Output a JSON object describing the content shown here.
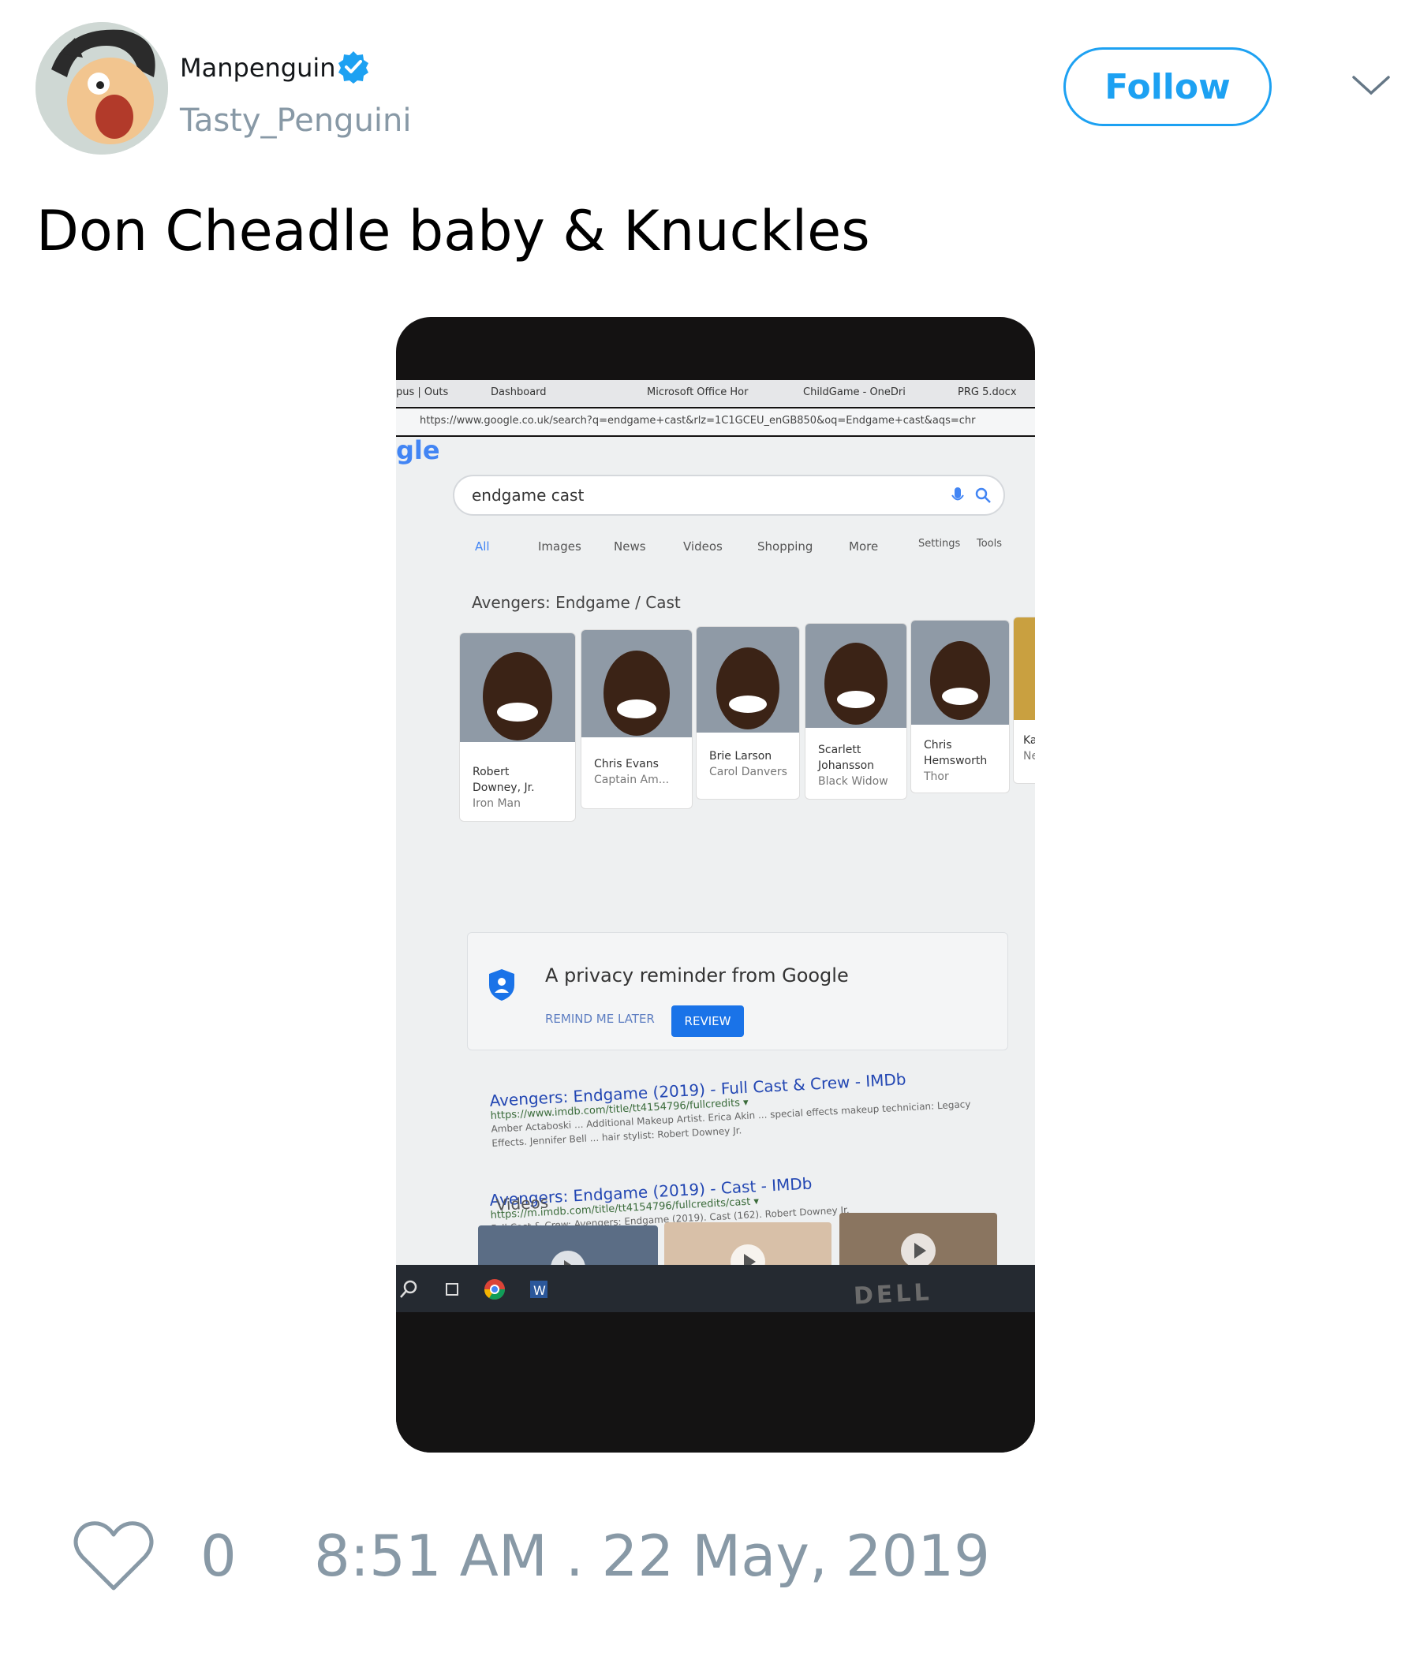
{
  "tweet": {
    "display_name": "Manpenguin",
    "handle": "Tasty_Penguini",
    "follow_label": "Follow",
    "text": "Don Cheadle baby & Knuckles",
    "like_count": "0",
    "timestamp": "8:51 AM . 22 May, 2019",
    "verified": true,
    "colors": {
      "accent": "#1da1f2",
      "muted": "#8899a6"
    }
  },
  "photo": {
    "tabs": [
      "pus | Outs",
      "Dashboard",
      "Microsoft Office Hor",
      "ChildGame - OneDri",
      "PRG 5.docx"
    ],
    "url": "https://www.google.co.uk/search?q=endgame+cast&rlz=1C1GCEU_enGB850&oq=Endgame+cast&aqs=chr",
    "logo_fragment": "gle",
    "query": "endgame cast",
    "nav": [
      "All",
      "Images",
      "News",
      "Videos",
      "Shopping",
      "More",
      "Settings",
      "Tools"
    ],
    "cast_title": "Avengers: Endgame / Cast",
    "cast": [
      {
        "name1": "Robert",
        "name2": "Downey, Jr.",
        "role": "Iron Man"
      },
      {
        "name1": "Chris Evans",
        "name2": "",
        "role": "Captain Am..."
      },
      {
        "name1": "Brie Larson",
        "name2": "",
        "role": "Carol Danvers"
      },
      {
        "name1": "Scarlett",
        "name2": "Johansson",
        "role": "Black Widow"
      },
      {
        "name1": "Chris",
        "name2": "Hemsworth",
        "role": "Thor"
      },
      {
        "name1": "Ka",
        "name2": "",
        "role": "Ne"
      }
    ],
    "privacy": {
      "title": "A privacy reminder from Google",
      "remind": "REMIND ME LATER",
      "review": "REVIEW"
    },
    "results": [
      {
        "title": "Avengers: Endgame (2019) - Full Cast & Crew - IMDb",
        "url": "https://www.imdb.com/title/tt4154796/fullcredits ▾",
        "snippet1": "Amber Actaboski ... Additional Makeup Artist. Erica Akin ... special effects makeup technician: Legacy",
        "snippet2": "Effects. Jennifer Bell ... hair stylist: Robert Downey Jr."
      },
      {
        "title": "Avengers: Endgame (2019) - Cast - IMDb",
        "url": "https://m.imdb.com/title/tt4154796/fullcredits/cast ▾",
        "snippet1": "Full Cast & Crew: Avengers: Endgame (2019). Cast (162). Robert Downey Jr.",
        "snippet2": ""
      }
    ],
    "videos_label": "Videos",
    "brand": "DELL"
  }
}
